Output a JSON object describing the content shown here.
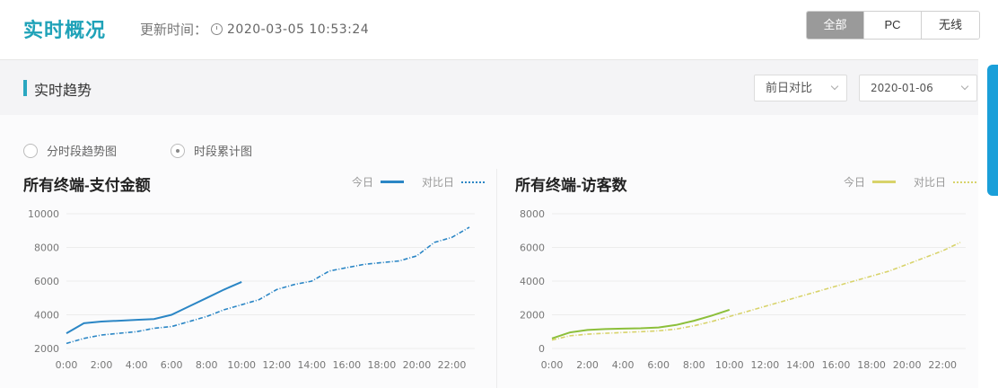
{
  "header": {
    "title": "实时概况",
    "update_label": "更新时间：",
    "update_time": "2020-03-05 10:53:24"
  },
  "terminal_tabs": [
    {
      "label": "全部",
      "active": true
    },
    {
      "label": "PC",
      "active": false
    },
    {
      "label": "无线",
      "active": false
    }
  ],
  "trend": {
    "title": "实时趋势",
    "compare_select": "前日对比",
    "date_select": "2020-01-06"
  },
  "radios": [
    {
      "label": "分时段趋势图",
      "checked": false
    },
    {
      "label": "时段累计图",
      "checked": true
    }
  ],
  "colors": {
    "accent": "#1fa2b8",
    "blue_series": "#2b86c5",
    "green_series": "#8cbf3a",
    "yellow_series": "#d8d36a"
  },
  "chart_data": [
    {
      "type": "line",
      "title": "所有终端-支付金额",
      "x": [
        "0:00",
        "2:00",
        "4:00",
        "6:00",
        "8:00",
        "10:00",
        "12:00",
        "14:00",
        "16:00",
        "18:00",
        "20:00",
        "22:00"
      ],
      "ylim": [
        2000,
        10000
      ],
      "yticks": [
        2000,
        4000,
        6000,
        8000,
        10000
      ],
      "xlabel": "",
      "ylabel": "",
      "legend": "top-right",
      "series": [
        {
          "name": "今日",
          "style": "solid",
          "x": [
            0,
            1,
            2,
            3,
            4,
            5,
            6,
            7,
            8,
            9,
            10
          ],
          "values": [
            2900,
            3500,
            3600,
            3650,
            3700,
            3750,
            4000,
            4500,
            5000,
            5500,
            5950
          ]
        },
        {
          "name": "对比日",
          "style": "dashed",
          "x": [
            0,
            1,
            2,
            3,
            4,
            5,
            6,
            7,
            8,
            9,
            10,
            11,
            12,
            13,
            14,
            15,
            16,
            17,
            18,
            19,
            20,
            21,
            22,
            23
          ],
          "values": [
            2300,
            2600,
            2800,
            2900,
            3000,
            3200,
            3300,
            3600,
            3900,
            4300,
            4600,
            4900,
            5500,
            5800,
            6000,
            6600,
            6800,
            7000,
            7100,
            7200,
            7500,
            8300,
            8600,
            9200
          ]
        }
      ]
    },
    {
      "type": "line",
      "title": "所有终端-访客数",
      "x": [
        "0:00",
        "2:00",
        "4:00",
        "6:00",
        "8:00",
        "10:00",
        "12:00",
        "14:00",
        "16:00",
        "18:00",
        "20:00",
        "22:00"
      ],
      "ylim": [
        0,
        8000
      ],
      "yticks": [
        0,
        2000,
        4000,
        6000,
        8000
      ],
      "xlabel": "",
      "ylabel": "",
      "legend": "top-right",
      "series": [
        {
          "name": "今日",
          "style": "solid",
          "x": [
            0,
            1,
            2,
            3,
            4,
            5,
            6,
            7,
            8,
            9,
            10
          ],
          "values": [
            600,
            950,
            1100,
            1150,
            1180,
            1200,
            1250,
            1400,
            1650,
            1950,
            2300
          ]
        },
        {
          "name": "对比日",
          "style": "dashed",
          "x": [
            0,
            1,
            2,
            3,
            4,
            5,
            6,
            7,
            8,
            9,
            10,
            11,
            12,
            13,
            14,
            15,
            16,
            17,
            18,
            19,
            20,
            21,
            22,
            23
          ],
          "values": [
            500,
            750,
            850,
            900,
            950,
            1000,
            1050,
            1150,
            1350,
            1600,
            1900,
            2200,
            2500,
            2800,
            3100,
            3400,
            3700,
            4000,
            4300,
            4600,
            5000,
            5400,
            5800,
            6300
          ]
        }
      ]
    }
  ]
}
